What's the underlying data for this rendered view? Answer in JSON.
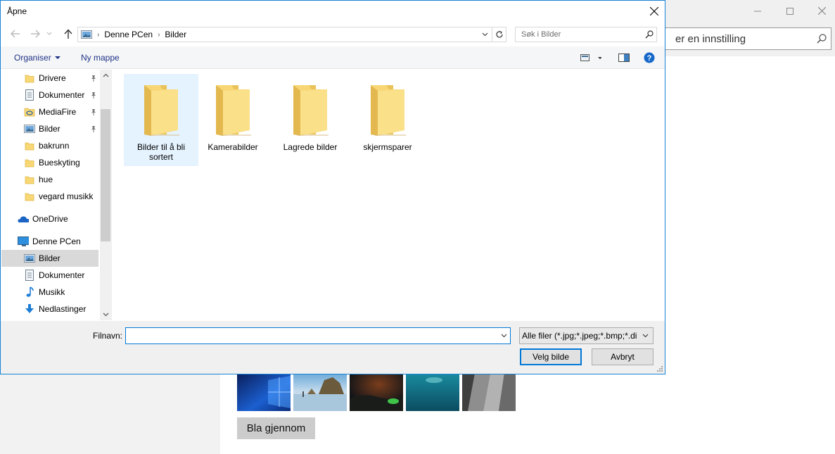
{
  "background": {
    "search_text": "er en innstilling",
    "browse_label": "Bla gjennom",
    "window_controls": [
      "minimize-icon",
      "maximize-icon",
      "close-icon"
    ]
  },
  "dialog": {
    "title": "Åpne",
    "address": {
      "segments": [
        "Denne PCen",
        "Bilder"
      ]
    },
    "search_placeholder": "Søk i Bilder",
    "toolbar": {
      "organize_label": "Organiser",
      "new_folder_label": "Ny mappe"
    },
    "nav": {
      "items": [
        {
          "label": "Drivere",
          "icon": "folder-icon",
          "pinned": true
        },
        {
          "label": "Dokumenter",
          "icon": "documents-icon",
          "pinned": true
        },
        {
          "label": "MediaFire",
          "icon": "mediafire-icon",
          "pinned": true
        },
        {
          "label": "Bilder",
          "icon": "pictures-icon",
          "pinned": true
        },
        {
          "label": "bakrunn",
          "icon": "folder-icon",
          "pinned": false
        },
        {
          "label": "Bueskyting",
          "icon": "folder-icon",
          "pinned": false
        },
        {
          "label": "hue",
          "icon": "folder-icon",
          "pinned": false
        },
        {
          "label": "vegard musikk",
          "icon": "folder-icon",
          "pinned": false
        },
        {
          "label": "OneDrive",
          "icon": "onedrive-icon",
          "pinned": false
        },
        {
          "label": "Denne PCen",
          "icon": "computer-icon",
          "pinned": false
        },
        {
          "label": "Bilder",
          "icon": "pictures-icon",
          "pinned": false,
          "selected": true
        },
        {
          "label": "Dokumenter",
          "icon": "documents-icon",
          "pinned": false
        },
        {
          "label": "Musikk",
          "icon": "music-icon",
          "pinned": false
        },
        {
          "label": "Nedlastinger",
          "icon": "downloads-icon",
          "pinned": false
        }
      ]
    },
    "folders": [
      {
        "label": "Bilder til å bli sortert",
        "selected": true
      },
      {
        "label": "Kamerabilder"
      },
      {
        "label": "Lagrede bilder"
      },
      {
        "label": "skjermsparer"
      }
    ],
    "filename_label": "Filnavn:",
    "filename_value": "",
    "filter_value": "Alle filer (*.jpg;*.jpeg;*.bmp;*.di",
    "ok_label": "Velg bilde",
    "cancel_label": "Avbryt",
    "colors": {
      "accent": "#0078d7",
      "link": "#1e3287",
      "folder": "#f8d775"
    }
  }
}
